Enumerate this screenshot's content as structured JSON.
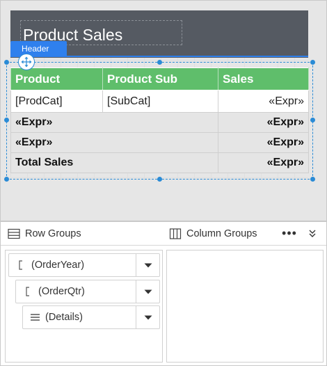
{
  "report": {
    "title": "Product Sales",
    "header_tab": "Header"
  },
  "table": {
    "headers": [
      "Product",
      "Product Sub",
      "Sales"
    ],
    "detail_row": [
      "[ProdCat]",
      "[SubCat]",
      "«Expr»"
    ],
    "group_rows": [
      [
        "«Expr»",
        "«Expr»"
      ],
      [
        "«Expr»",
        "«Expr»"
      ],
      [
        "Total Sales",
        "«Expr»"
      ]
    ]
  },
  "grouping_pane": {
    "row_groups_label": "Row Groups",
    "column_groups_label": "Column Groups",
    "more_label": "•••",
    "row_groups": [
      {
        "label": "(OrderYear)",
        "icon": "bracket-icon"
      },
      {
        "label": "(OrderQtr)",
        "icon": "bracket-icon"
      },
      {
        "label": "(Details)",
        "icon": "details-lines-icon"
      }
    ]
  },
  "colors": {
    "header_band": "#555a62",
    "accent_blue": "#2f80ed",
    "table_header_green": "#5fbe6b",
    "group_row_gray": "#e5e5e5"
  }
}
